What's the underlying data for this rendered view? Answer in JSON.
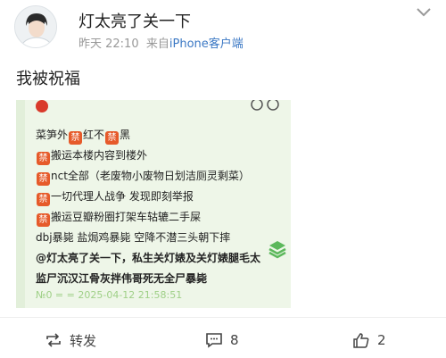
{
  "post": {
    "author": "灯太亮了关一下",
    "time": "昨天 22:10",
    "source_prefix": "来自",
    "source_name": "iPhone客户端",
    "text": "我被祝福"
  },
  "image": {
    "lines": [
      {
        "parts": [
          "菜笋外",
          "禁",
          "红不",
          "禁",
          "黑"
        ]
      },
      {
        "parts": [
          "",
          "禁",
          "搬运本楼内容到楼外"
        ]
      },
      {
        "parts": [
          "",
          "禁",
          "nct全部（老废物小废物日划洁厕灵剩菜）"
        ]
      },
      {
        "parts": [
          "",
          "禁",
          "一切代理人战争 发现即刻举报"
        ]
      },
      {
        "parts": [
          "",
          "禁",
          "搬运豆瓣粉圈打架车轱辘二手屎"
        ]
      },
      {
        "parts": [
          "dbj暴毙 盐焗鸡暴毙 空降不潜三头朝下摔"
        ]
      },
      {
        "parts": [
          "@灯太亮了关一下，私生关灯婊及关灯婊腿毛太"
        ],
        "bold": true
      },
      {
        "parts": [
          "监尸沉汉江骨灰拌伟哥死无全尸暴毙"
        ],
        "bold": true
      }
    ],
    "stamp": "№0 = = 2025-04-12 21:58:51"
  },
  "actions": {
    "repost_label": "转发",
    "comment_count": "8",
    "like_count": "2"
  },
  "icons": [
    "avatar",
    "chevron-down-icon",
    "apple-icon",
    "layers-icon",
    "repost-icon",
    "comment-icon",
    "like-icon"
  ]
}
